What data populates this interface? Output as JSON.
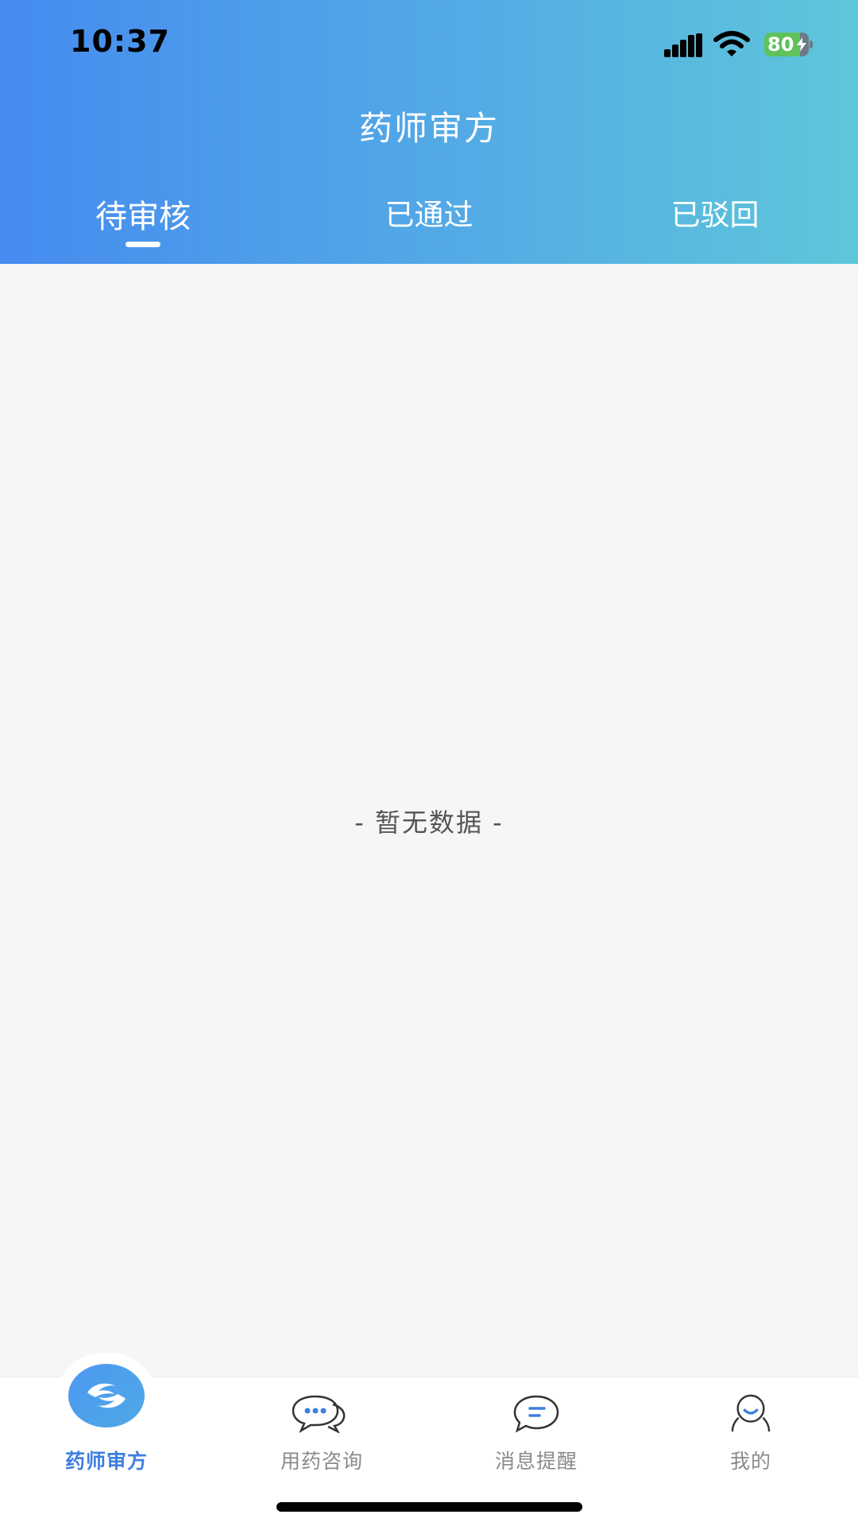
{
  "status_bar": {
    "time": "10:37",
    "battery": "80",
    "battery_level": 0.8,
    "icons": [
      "signal-icon",
      "wifi-icon",
      "battery-icon"
    ]
  },
  "header": {
    "title": "药师审方",
    "gradient_colors": [
      "#458bf0",
      "#5ec6da"
    ]
  },
  "tabs": [
    {
      "label": "待审核",
      "active": true
    },
    {
      "label": "已通过",
      "active": false
    },
    {
      "label": "已驳回",
      "active": false
    }
  ],
  "content": {
    "empty_text": "- 暂无数据 -"
  },
  "bottom_nav": {
    "items": [
      {
        "label": "药师审方",
        "icon": "pharmacist-review-icon",
        "active": true
      },
      {
        "label": "用药咨询",
        "icon": "chat-bubbles-icon",
        "active": false
      },
      {
        "label": "消息提醒",
        "icon": "message-icon",
        "active": false
      },
      {
        "label": "我的",
        "icon": "user-icon",
        "active": false
      }
    ],
    "active_color": "#3d7fe0",
    "inactive_color": "#8a8a8a"
  }
}
